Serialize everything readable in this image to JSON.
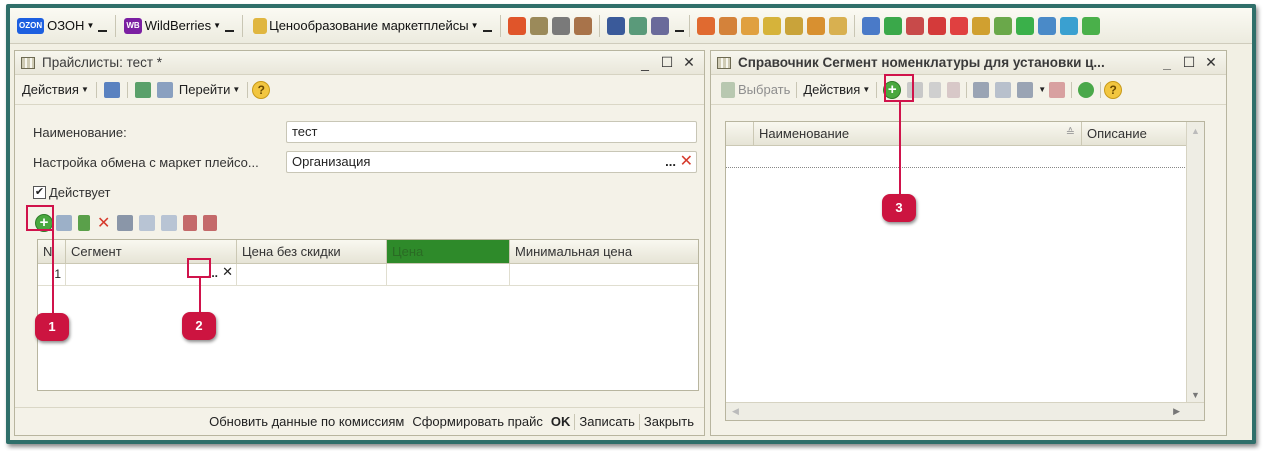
{
  "toolbar": {
    "ozon_logo": "OZON",
    "ozon_label": "ОЗОН",
    "wb_logo": "WB",
    "wb_label": "WildBerries",
    "pricing_label": "Ценообразование маркетплейсы"
  },
  "left_window": {
    "title": "Прайслисты: тест *",
    "actions_label": "Действия",
    "goto_label": "Перейти",
    "name_label": "Наименование:",
    "name_value": "тест",
    "exchange_label": "Настройка обмена с маркет плейсо...",
    "exchange_value": "Организация",
    "active_label": "Действует",
    "active_checked": true,
    "table": {
      "columns": [
        "N",
        "Сегмент",
        "Цена без скидки",
        "Цена",
        "Минимальная цена"
      ],
      "rows": [
        {
          "n": "1",
          "segment": "",
          "price_no_discount": "",
          "price": "",
          "min_price": ""
        }
      ]
    },
    "footer": {
      "update_commissions": "Обновить данные по комиссиям",
      "generate_price": "Сформировать прайс",
      "ok": "OK",
      "save": "Записать",
      "close": "Закрыть"
    }
  },
  "right_window": {
    "title": "Справочник Сегмент номенклатуры для установки ц...",
    "select_label": "Выбрать",
    "actions_label": "Действия",
    "table": {
      "columns": [
        "Наименование",
        "Описание"
      ]
    }
  },
  "markers": {
    "m1": "1",
    "m2": "2",
    "m3": "3"
  },
  "colors": {
    "frame": "#2f6f6a",
    "highlight": "#d0134b",
    "price_header": "#2e8a2a"
  }
}
